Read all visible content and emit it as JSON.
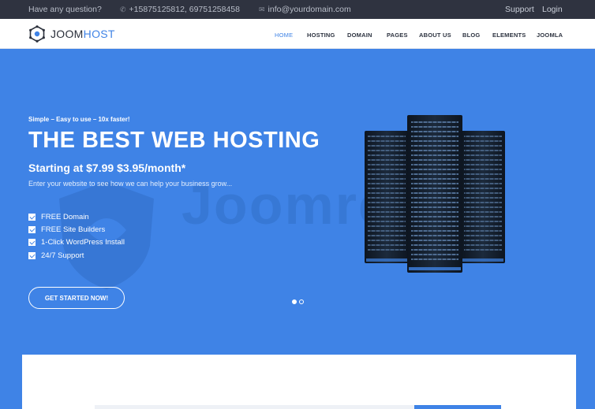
{
  "topbar": {
    "question": "Have any question?",
    "phone": "+15875125812, 69751258458",
    "email": "info@yourdomain.com",
    "support": "Support",
    "login": "Login"
  },
  "logo": {
    "part1": "JOOM",
    "part2": "HOST"
  },
  "nav": [
    {
      "label": "HOME",
      "active": true
    },
    {
      "label": "HOSTING"
    },
    {
      "label": "DOMAIN"
    },
    {
      "label": "PAGES"
    },
    {
      "label": "ABOUT US"
    },
    {
      "label": "BLOG"
    },
    {
      "label": "ELEMENTS"
    },
    {
      "label": "JOOMLA"
    }
  ],
  "hero": {
    "tagline": "Simple – Easy to use – 10x faster!",
    "headline": "THE BEST WEB HOSTING",
    "price_prefix": "Starting at",
    "price_old": "$7.99",
    "price_new": "$3.95/month*",
    "subtext": "Enter your website to see how we can help your business grow...",
    "features": [
      "FREE Domain",
      "FREE Site Builders",
      "1-Click WordPress Install",
      "24/7 Support"
    ],
    "cta": "GET STARTED NOW!",
    "slides_total": 2,
    "slide_active": 1,
    "watermark": "Joomreaid"
  },
  "colors": {
    "accent": "#3f83e6",
    "topbar": "#2f3340",
    "white": "#ffffff"
  },
  "icons": [
    "phone-icon",
    "mail-icon",
    "logo-hexagon-icon",
    "check-icon",
    "server-image"
  ]
}
